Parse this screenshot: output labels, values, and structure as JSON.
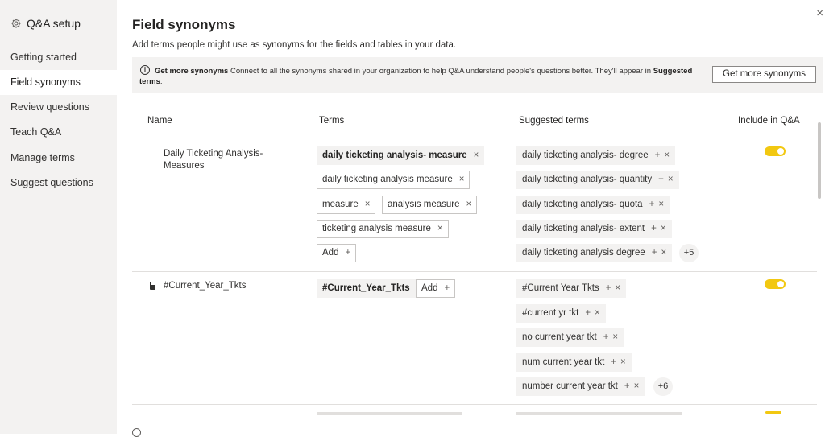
{
  "sidebar": {
    "title": "Q&A setup",
    "title_icon": "gear-icon",
    "items": [
      {
        "label": "Getting started"
      },
      {
        "label": "Field synonyms",
        "active": true
      },
      {
        "label": "Review questions"
      },
      {
        "label": "Teach Q&A"
      },
      {
        "label": "Manage terms"
      },
      {
        "label": "Suggest questions"
      }
    ]
  },
  "header": {
    "title": "Field synonyms",
    "subtitle": "Add terms people might use as synonyms for the fields and tables in your data.",
    "close": "×"
  },
  "banner": {
    "icon": "i",
    "bold_lead": "Get more synonyms",
    "text": " Connect to all the synonyms shared in your organization to help Q&A understand people's questions better. They'll appear in ",
    "bold_tail": "Suggested terms",
    "end": ".",
    "button": "Get more synonyms"
  },
  "columns": {
    "name": "Name",
    "terms": "Terms",
    "suggested": "Suggested terms",
    "include": "Include in Q&A"
  },
  "ui": {
    "remove": "×",
    "add_plus": "+",
    "add_label": "Add",
    "accent": "#f2c811"
  },
  "rows": [
    {
      "name_line1": "Daily Ticketing Analysis-",
      "name_line2": "Measures",
      "terms": [
        "daily ticketing analysis- measure",
        "daily ticketing analysis measure",
        "measure",
        "analysis measure",
        "ticketing analysis measure"
      ],
      "suggested": [
        "daily ticketing analysis- degree",
        "daily ticketing analysis- quantity",
        "daily ticketing analysis- quota",
        "daily ticketing analysis- extent",
        "daily ticketing analysis degree"
      ],
      "more": "+5",
      "include": true
    },
    {
      "name_line1": "#Current_Year_Tkts",
      "terms": [
        "#Current_Year_Tkts"
      ],
      "suggested": [
        "#Current Year Tkts",
        "#current yr tkt",
        "no current year tkt",
        "num current year tkt",
        "number current year tkt"
      ],
      "more": "+6",
      "include": true
    }
  ]
}
